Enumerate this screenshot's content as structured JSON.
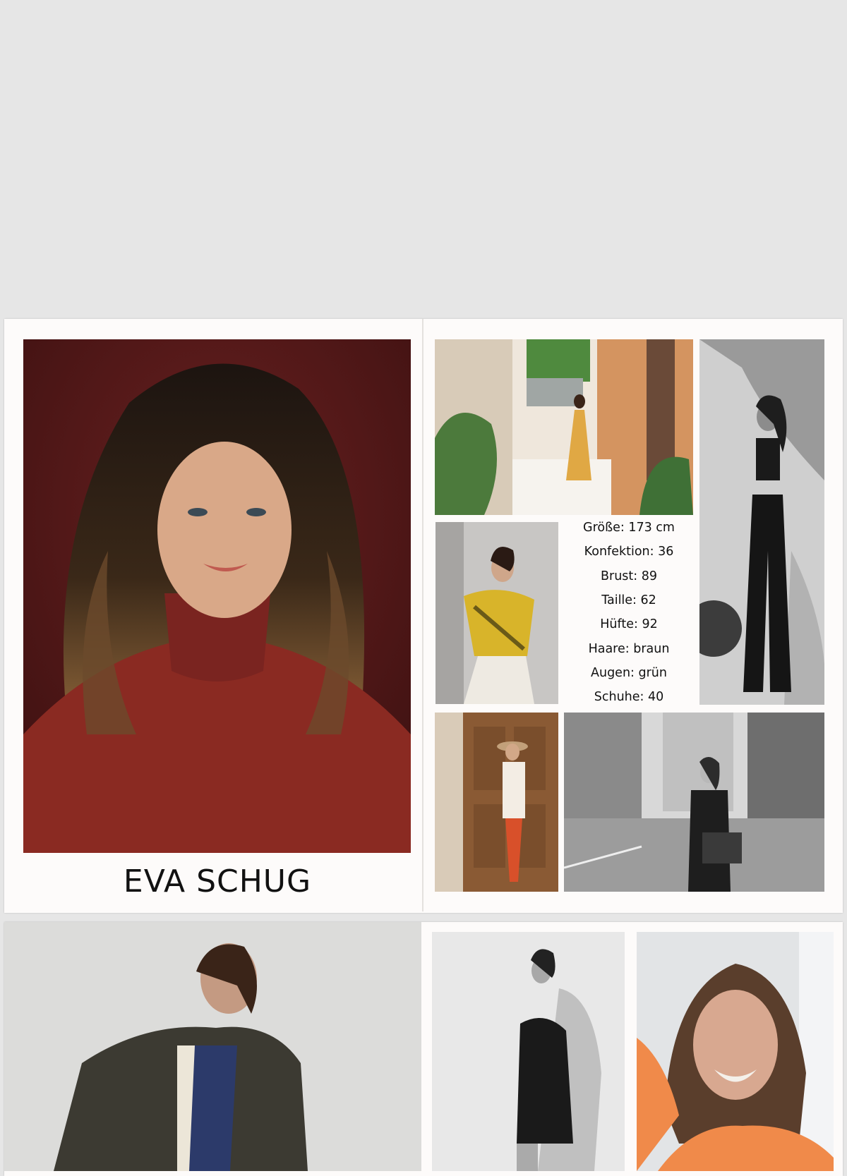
{
  "model": {
    "name": "EVA SCHUG"
  },
  "stats": [
    {
      "label": "Größe",
      "value": "173 cm"
    },
    {
      "label": "Konfektion",
      "value": "36"
    },
    {
      "label": "Brust",
      "value": "89"
    },
    {
      "label": "Taille",
      "value": "62"
    },
    {
      "label": "Hüfte",
      "value": "92"
    },
    {
      "label": "Haare",
      "value": "braun"
    },
    {
      "label": "Augen",
      "value": "grün"
    },
    {
      "label": "Schuhe",
      "value": "40"
    }
  ],
  "stat_lines": [
    "Größe: 173 cm",
    "Konfektion: 36",
    "Brust: 89",
    "Taille: 62",
    "Hüfte: 92",
    "Haare: braun",
    "Augen: grün",
    "Schuhe: 40"
  ],
  "colors": {
    "background": "#e6e6e6",
    "page": "#fdfbfa",
    "portrait_backdrop": "#5a1a1a",
    "sweater_red": "#8a2a22",
    "text": "#111111"
  }
}
